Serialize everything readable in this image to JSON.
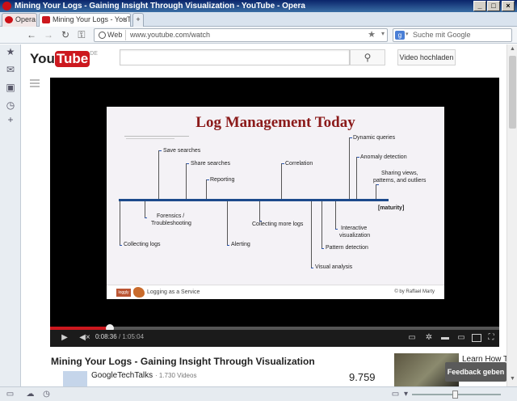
{
  "window": {
    "title": "Mining Your Logs - Gaining Insight Through Visualization - YouTube - Opera",
    "min": "_",
    "max": "□",
    "close": "×"
  },
  "tabs": {
    "menu_label": "Opera",
    "active_label": "Mining Your Logs - YouTube - Gainin...",
    "close": "×",
    "new": "+"
  },
  "address": {
    "badge": "Web",
    "url": "www.youtube.com/watch",
    "search_placeholder": "Suche mit Google"
  },
  "youtube": {
    "logo_you": "You",
    "logo_tube": "Tube",
    "region": "DE",
    "search_value": "",
    "upload_label": "Video hochladen"
  },
  "slide": {
    "title": "Log Management Today",
    "labels": {
      "collecting_logs": "Collecting logs",
      "save_searches": "Save searches",
      "forensics": "Forensics /",
      "troubleshooting": "Troubleshooting",
      "share_searches": "Share searches",
      "reporting": "Reporting",
      "alerting": "Alerting",
      "collecting_more_logs": "Collecting more logs",
      "correlation": "Correlation",
      "visual_analysis": "Visual analysis",
      "pattern_detection": "Pattern detection",
      "interactive": "Interactive",
      "visualization": "visualization",
      "dynamic_queries": "Dynamic queries",
      "anomaly_detection": "Anomaly detection",
      "sharing_views": "Sharing views,",
      "patterns_outliers": "patterns, and outliers",
      "maturity": "[maturity]"
    },
    "footer_logo": "loggly",
    "footer_left": "Logging as a Service",
    "footer_right": "© by Raffael Marty"
  },
  "player": {
    "current_time": "0:08:36",
    "duration": "/ 1:05:04",
    "progress": 0.133
  },
  "video": {
    "title": "Mining Your Logs - Gaining Insight Through Visualization",
    "channel": "GoogleTechTalks",
    "channel_videos": "· 1.730 Videos",
    "views": "9.759"
  },
  "suggestion": {
    "title": "Learn How Te"
  },
  "feedback": {
    "label": "Feedback geben"
  }
}
